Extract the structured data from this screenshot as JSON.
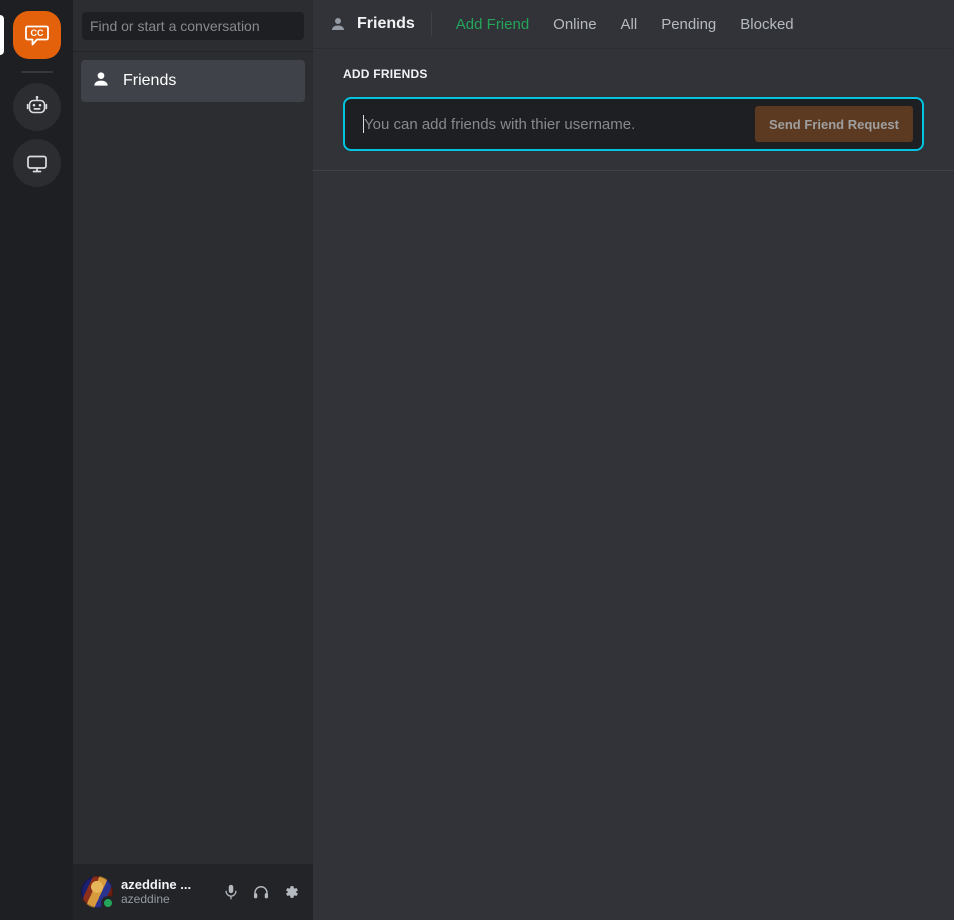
{
  "colors": {
    "brand_orange": "#e2610a",
    "accent_cyan": "#00c4e0",
    "active_tab_green": "#23a55a",
    "status_online": "#23a55a",
    "rail_bg": "#1e1f22",
    "sidebar_bg": "#2b2d31",
    "main_bg": "#313338",
    "send_button_bg": "#5c3a22"
  },
  "rail": {
    "items": [
      {
        "name": "cc-home",
        "icon": "cc-speech-bubble-icon",
        "label": "CC",
        "active": true
      },
      {
        "name": "bot",
        "icon": "robot-icon",
        "label": "",
        "active": false
      },
      {
        "name": "display",
        "icon": "monitor-icon",
        "label": "",
        "active": false
      }
    ]
  },
  "sidebar": {
    "search": {
      "value": "",
      "placeholder": "Find or start a conversation"
    },
    "items": [
      {
        "label": "Friends",
        "icon": "person-icon",
        "selected": true
      }
    ],
    "user_panel": {
      "display_name": "azeddine ...",
      "username": "azeddine",
      "status": "online",
      "actions": [
        {
          "name": "microphone-icon",
          "label": "Mute"
        },
        {
          "name": "headphones-icon",
          "label": "Deafen"
        },
        {
          "name": "gear-icon",
          "label": "User Settings"
        }
      ]
    }
  },
  "topbar": {
    "title": "Friends",
    "title_icon": "person-icon",
    "tabs": [
      {
        "label": "Add Friend",
        "active": true
      },
      {
        "label": "Online",
        "active": false
      },
      {
        "label": "All",
        "active": false
      },
      {
        "label": "Pending",
        "active": false
      },
      {
        "label": "Blocked",
        "active": false
      }
    ]
  },
  "main": {
    "section_title": "ADD FRIENDS",
    "add_friend": {
      "input_value": "",
      "placeholder": "You can add friends with thier username.",
      "focused": true,
      "button_label": "Send Friend Request",
      "button_disabled": true
    }
  }
}
